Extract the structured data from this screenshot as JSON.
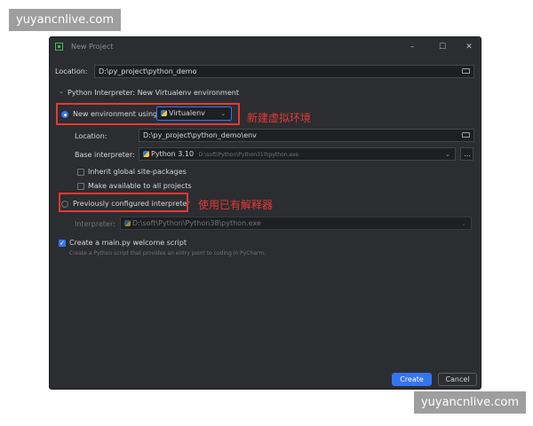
{
  "watermark": {
    "text": "yuyancnlive.com"
  },
  "window": {
    "title": "New Project",
    "controls": {
      "minimize": "–",
      "maximize": "☐",
      "close": "✕"
    }
  },
  "location": {
    "label": "Location:",
    "value": "D:\\py_project\\python_demo"
  },
  "interpreter_section": {
    "title": "Python Interpreter: New Virtualenv environment"
  },
  "new_env": {
    "radio_label": "New environment using",
    "tool": "Virtualenv",
    "location_label": "Location:",
    "location_value": "D:\\py_project\\python_demo\\env",
    "base_label": "Base interpreter:",
    "base_name": "Python 3.10",
    "base_path": "D:\\soft\\Python\\Python310\\python.exe",
    "inherit_label": "Inherit global site-packages",
    "available_label": "Make available to all projects"
  },
  "previous": {
    "radio_label": "Previously configured interpreter",
    "interpreter_label": "Interpreter:",
    "interpreter_value": "D:\\soft\\Python\\Python38\\python.exe"
  },
  "welcome": {
    "label": "Create a main.py welcome script",
    "hint": "Create a Python script that provides an entry point to coding in PyCharm."
  },
  "annotations": {
    "new_env": "新建虚拟环境",
    "existing": "使用已有解释器"
  },
  "buttons": {
    "create": "Create",
    "cancel": "Cancel"
  },
  "colors": {
    "accent": "#3574f0",
    "annotation": "#e53935",
    "dialog_bg": "#2b2d30",
    "field_bg": "#1e1f22"
  }
}
